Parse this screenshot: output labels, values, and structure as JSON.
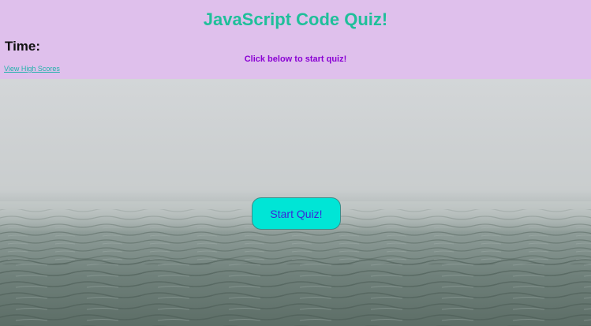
{
  "header": {
    "title": "JavaScript Code Quiz!",
    "timer_label": "Time:",
    "instruction": "Click below to start quiz!",
    "high_scores_link": "View High Scores"
  },
  "main": {
    "start_button_label": "Start Quiz!"
  },
  "colors": {
    "header_background": "#dfc0ec",
    "title": "#1fbf9a",
    "instruction": "#8a00d4",
    "link": "#20b2aa",
    "button_background": "#00e5d6",
    "button_text": "#3b26d9"
  },
  "background_image": "foggy-sea-horizon"
}
